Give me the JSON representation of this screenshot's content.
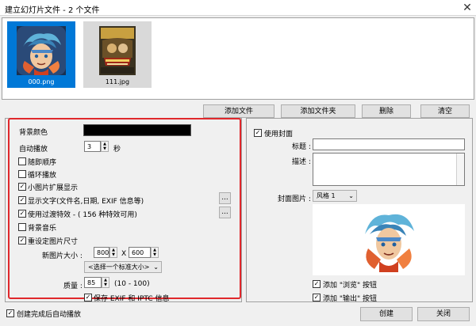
{
  "window": {
    "title": "建立幻灯片文件 - 2 个文件",
    "close_glyph": "✕"
  },
  "thumbnails": [
    {
      "label": "000.png",
      "selected": true
    },
    {
      "label": "111.jpg",
      "selected": false
    }
  ],
  "file_buttons": {
    "add_files": "添加文件",
    "add_folder": "添加文件夹",
    "delete": "删除",
    "clear": "清空"
  },
  "left": {
    "bg_color_label": "背景颜色",
    "bg_color_value": "#000000",
    "autoplay_label": "自动播放",
    "autoplay_value": "3",
    "autoplay_unit": "秒",
    "random_order": "随即顺序",
    "loop_play": "循环播放",
    "small_image_expand": "小图片扩展显示",
    "show_text": "显示文字(文件名,日期, EXIF 信息等)",
    "use_transition": "使用过渡特效 - ( 156 种特效可用)",
    "background_music": "背景音乐",
    "resize_images": "重设定图片尺寸",
    "new_size_label": "新图片大小 :",
    "width_value": "800",
    "size_x": "X",
    "height_value": "600",
    "standard_size_select": "<选择一个标准大小>",
    "quality_label": "质量 :",
    "quality_value": "85",
    "quality_range": "(10 - 100)",
    "keep_exif": "保存 EXIF 和 IPTC 信息",
    "dots_glyph": "..."
  },
  "right": {
    "use_cover": "使用封面",
    "cover_title_label": "标题 :",
    "cover_desc_label": "描述 :",
    "cover_image_label": "封面图片 :",
    "cover_style_value": "风格 1",
    "add_browse": "添加 \"浏览\" 按钮",
    "add_output": "添加 \"输出\" 按钮"
  },
  "footer": {
    "autoplay_after_create": "创建完成后自动播放",
    "create": "创建",
    "close": "关闭"
  }
}
